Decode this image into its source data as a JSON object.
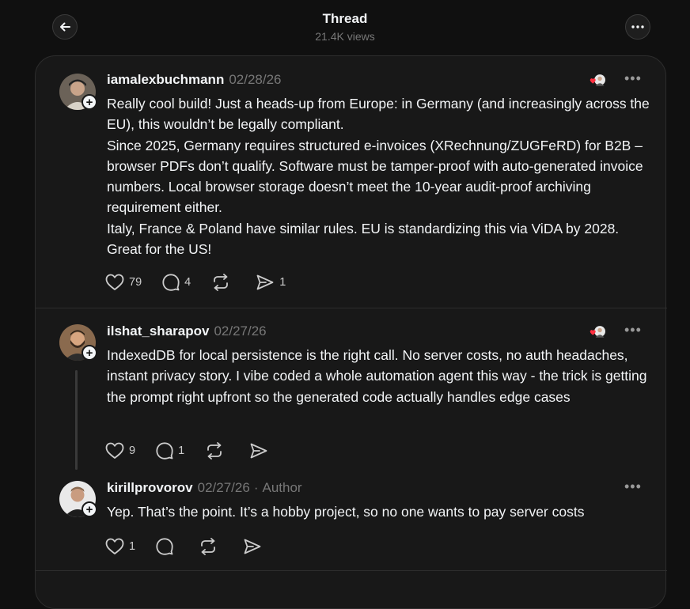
{
  "header": {
    "title": "Thread",
    "views": "21.4K views"
  },
  "posts": [
    {
      "username": "iamalexbuchmann",
      "date": "02/28/26",
      "body": [
        "Really cool build! Just a heads-up from Europe: in Germany (and increasingly across the EU), this wouldn’t be legally compliant.",
        "Since 2025, Germany requires structured e-invoices (XRechnung/ZUGFeRD) for B2B – browser PDFs don’t qualify. Software must be tamper-proof with auto-generated invoice numbers. Local browser storage doesn’t meet the 10-year audit-proof archiving requirement either.",
        "Italy, France & Poland have similar rules. EU is standardizing this via ViDA by 2028. Great for the US!"
      ],
      "likes": "79",
      "replies": "4",
      "reposts": "",
      "shares": "1"
    },
    {
      "username": "ilshat_sharapov",
      "date": "02/27/26",
      "body": [
        "IndexedDB for local persistence is the right call. No server costs, no auth headaches, instant privacy story. I vibe coded a whole automation agent this way - the trick is getting the prompt right upfront so the generated code actually handles edge cases"
      ],
      "likes": "9",
      "replies": "1",
      "reposts": "",
      "shares": ""
    },
    {
      "username": "kirillprovorov",
      "date": "02/27/26",
      "separator": "·",
      "author_label": "Author",
      "body": [
        "Yep. That’s the point. It’s a hobby project, so no one wants to pay server costs"
      ],
      "likes": "1",
      "replies": "",
      "reposts": "",
      "shares": ""
    }
  ],
  "icons": {
    "back": "arrow-left-icon",
    "more": "more-dots-icon",
    "like": "heart-icon",
    "reply": "comment-icon",
    "repost": "repost-icon",
    "share": "send-icon",
    "follow": "plus-icon"
  },
  "colors": {
    "background": "#101010",
    "card": "#181818",
    "text": "#f3f5f7",
    "muted": "#777777",
    "liked_heart": "#ff3040"
  }
}
